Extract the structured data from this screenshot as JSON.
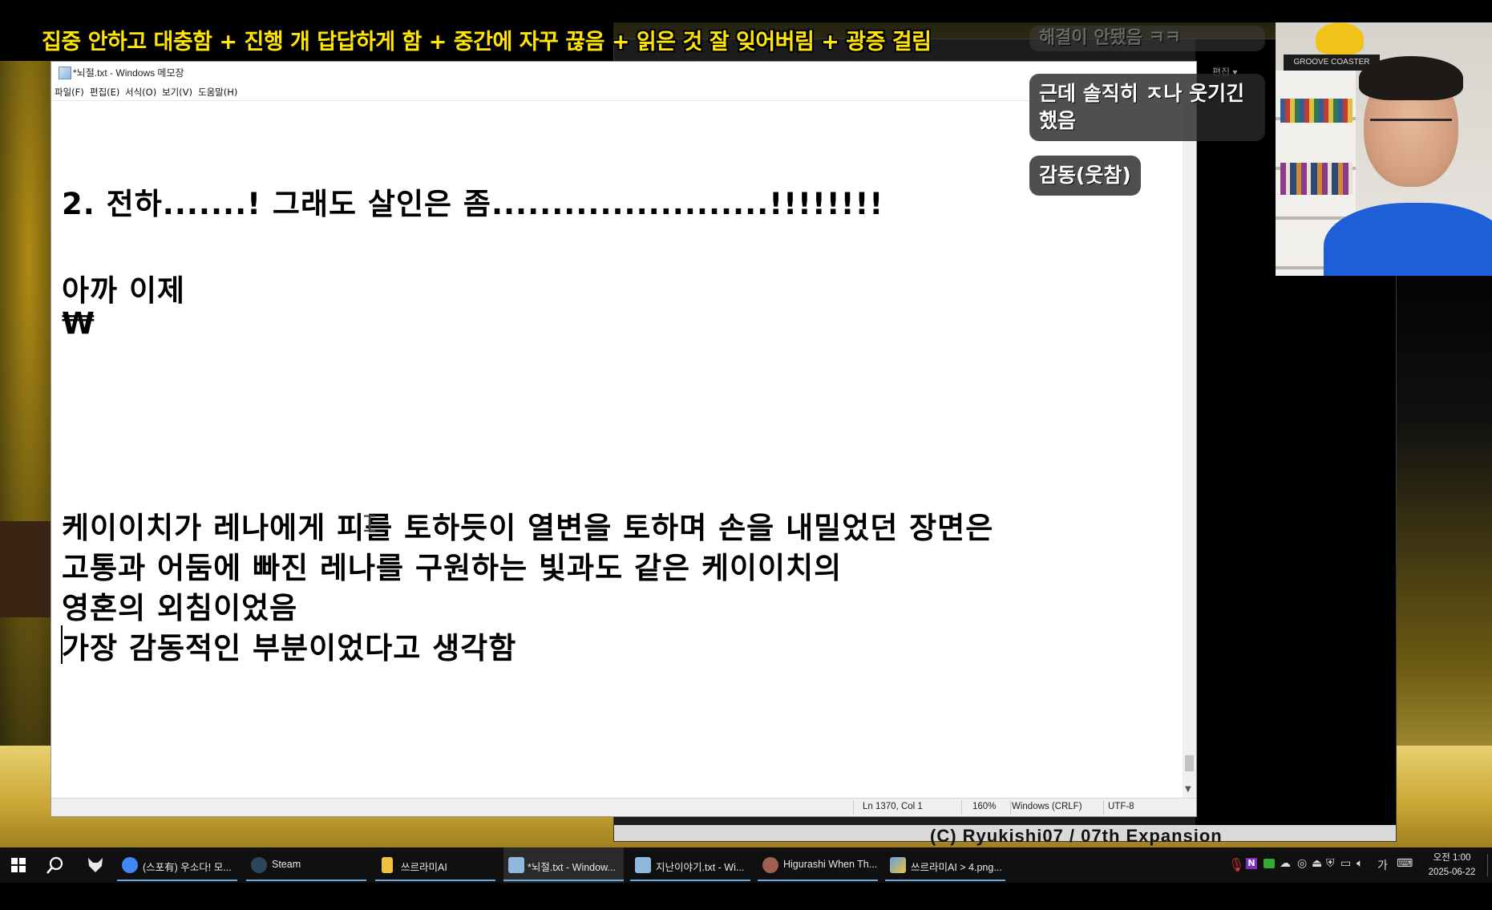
{
  "overlay": {
    "caption": "집중 안하고 대충함 + 진행 개 답답하게 함 + 중간에 자꾸 끊음 + 읽은 것 잘 잊어버림 + 광증 걸림"
  },
  "notepad": {
    "title": "*뇌절.txt - Windows 메모장",
    "menu": [
      "파일(F)",
      "편집(E)",
      "서식(O)",
      "보기(V)",
      "도움말(H)"
    ],
    "lines": [
      "2. 전하.......! 그래도 살인은 좀.......................!!!!!!!!",
      "아까 이제",
      "₩",
      "케이이치가 레나에게 피를 토하듯이 열변을 토하며 손을 내밀었던 장면은",
      "고통과 어둠에 빠진 레나를 구원하는 빛과도 같은 케이이치의",
      "영혼의 외침이었음",
      "가장 감동적인 부분이었다고 생각함"
    ],
    "status": {
      "position": "Ln 1370, Col 1",
      "zoom": "160%",
      "line_ending": "Windows (CRLF)",
      "encoding": "UTF-8"
    }
  },
  "chat": {
    "faded": "해결이 안됐음 ㅋㅋ",
    "msg1": "근데 솔직히 ㅈ나 웃기긴 했음",
    "msg2": "감동(웃참)"
  },
  "back_window": {
    "edit_menu": "편집 ▾",
    "credit": "(C) Ryukishi07 / 07th Expansion"
  },
  "webcam": {
    "sign": "GROOVE COASTER"
  },
  "taskbar": {
    "items": [
      {
        "label": "(스포有) 우소다! 모...",
        "icon": "chrome-icon",
        "color": "#4285f4"
      },
      {
        "label": "Steam",
        "icon": "steam-icon",
        "color": "#1b2838"
      },
      {
        "label": "쓰르라미AI",
        "icon": "folder-icon",
        "color": "#f0c040"
      },
      {
        "label": "*뇌절.txt - Window...",
        "icon": "notepad-icon",
        "color": "#8fb8dc"
      },
      {
        "label": "지난이야기.txt - Wi...",
        "icon": "notepad-icon",
        "color": "#8fb8dc"
      },
      {
        "label": "Higurashi When Th...",
        "icon": "higurashi-icon",
        "color": "#a06050"
      },
      {
        "label": "쓰르라미AI > 4.png...",
        "icon": "photos-icon",
        "color": "#60a0e0"
      }
    ],
    "ime": "가",
    "time": "오전 1:00",
    "date": "2025-06-22"
  }
}
